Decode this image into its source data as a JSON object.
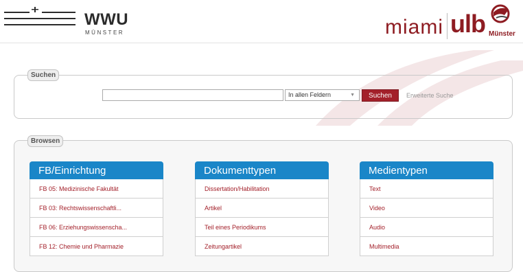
{
  "header": {
    "wwu_name": "WWU",
    "wwu_city": "MÜNSTER",
    "miami": "miami",
    "ulb": "ulb",
    "ulb_city": "Münster"
  },
  "search": {
    "legend": "Suchen",
    "input_value": "",
    "field_selected": "In allen Feldern",
    "button_label": "Suchen",
    "advanced_link": "Erweiterte Suche"
  },
  "browse": {
    "legend": "Browsen",
    "columns": [
      {
        "title": "FB/Einrichtung",
        "items": [
          "FB 05: Medizinische Fakultät",
          "FB 03: Rechtswissenschaftli...",
          "FB 06: Erziehungswissenscha...",
          "FB 12: Chemie und Pharmazie"
        ]
      },
      {
        "title": "Dokumenttypen",
        "items": [
          "Dissertation/Habilitation",
          "Artikel",
          "Teil eines Periodikums",
          "Zeitungartikel"
        ]
      },
      {
        "title": "Medientypen",
        "items": [
          "Text",
          "Video",
          "Audio",
          "Multimedia"
        ]
      }
    ]
  },
  "colors": {
    "accent_red": "#a3202a",
    "brand_red": "#8e1c22",
    "header_blue": "#1a86c8"
  }
}
